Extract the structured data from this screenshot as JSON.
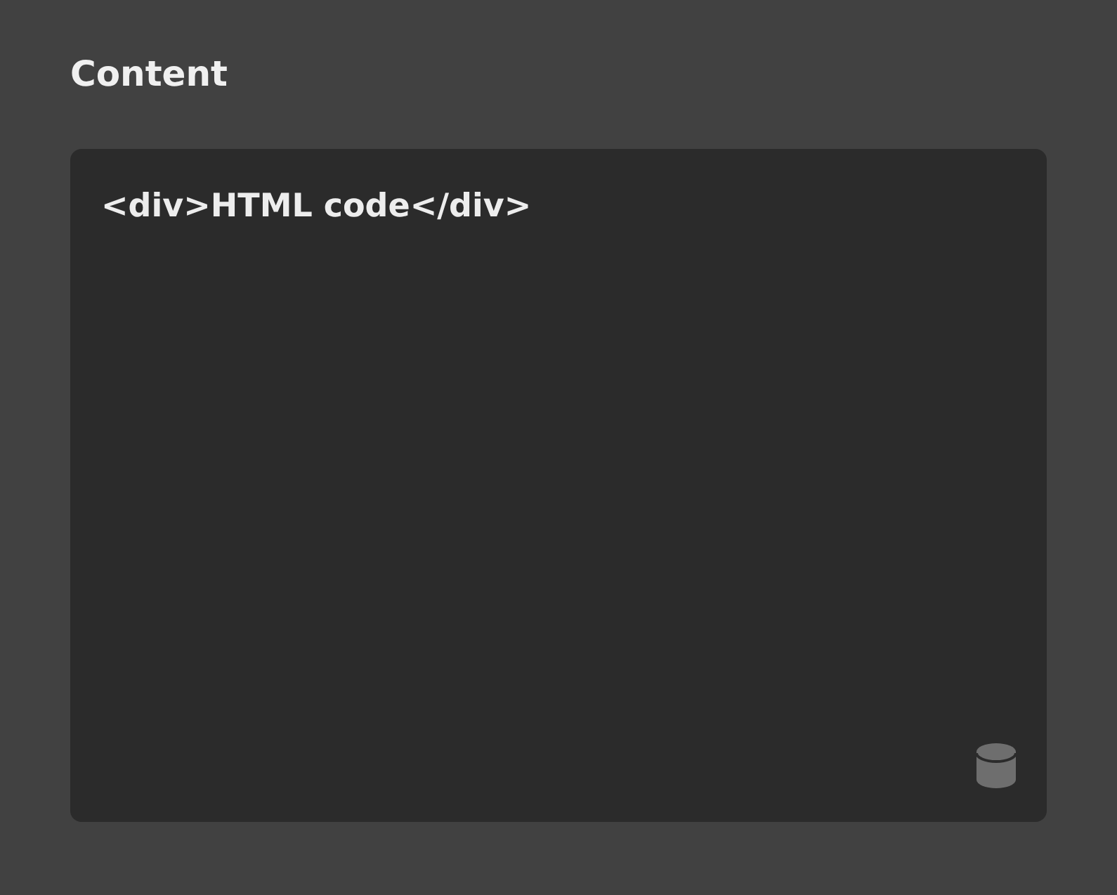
{
  "section": {
    "title": "Content"
  },
  "editor": {
    "value": "<div>HTML code</div>"
  }
}
